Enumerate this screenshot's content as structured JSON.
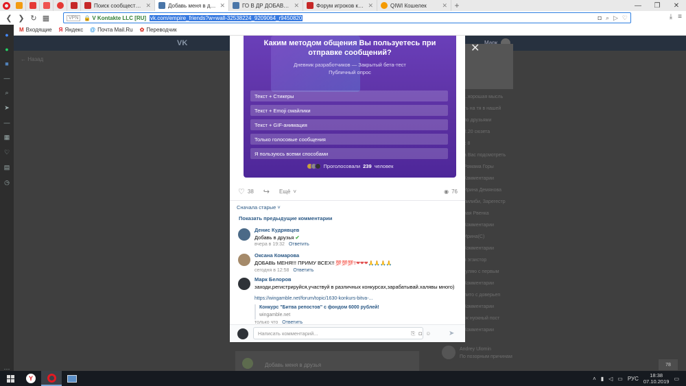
{
  "browser": {
    "tabs": [
      {
        "label": "Поиск сообщесто по загол",
        "favicon_color": "#c62828"
      },
      {
        "label": "Добавь меня в друзья",
        "favicon_color": "#4a76a8",
        "active": true
      },
      {
        "label": "ГО В ДР ДОБАВЬ В ДРУЗЬЯ",
        "favicon_color": "#4a76a8"
      },
      {
        "label": "Форум игроков казино - ",
        "favicon_color": "#c62828"
      },
      {
        "label": "QIWI Кошелек",
        "favicon_color": "#f59b00"
      }
    ],
    "address": {
      "vpn": "VPN",
      "security_label": "V Kontakte LLC [RU]",
      "url": "vk.com/empire_friends?w=wall-32538224_9209064_r9450820"
    },
    "bookmarks": [
      {
        "label": "Входящие",
        "icon": "gmail-icon",
        "color": "#d93025"
      },
      {
        "label": "Яндекс",
        "icon": "yandex-icon",
        "color": "#e21a22"
      },
      {
        "label": "Почта Mail.Ru",
        "icon": "mailru-icon",
        "color": "#168de2"
      },
      {
        "label": "Переводчик",
        "icon": "translate-icon",
        "color": "#d93025"
      }
    ]
  },
  "vk_header": {
    "logo": "VK",
    "user": "Марк"
  },
  "background_page": {
    "back_link": "Назад",
    "right_column": [
      "...хорошая мысль",
      "ть на тя в нашей",
      "по друзьями",
      "2.20 сюзета",
      "с 8",
      "а Вас подсмотреть",
      "Ромама Горы",
      "Камментарии",
      "Ирина Демянова",
      "лилиби, Зарегестр",
      "ная Рвенка",
      "Комментарии",
      "Ирина(С)",
      "Комментарии",
      "в эгзистор",
      "гуляю с первым",
      "Комментарии",
      "лито с доверьеп",
      "Комментарии",
      "ок нуокный пост",
      "Комментарии"
    ],
    "bottom_post_title": "Добавь меня в друзья",
    "bottom_author": "Andrey Ulomin",
    "bottom_author_meta": "По позорным причинам"
  },
  "post": {
    "poll": {
      "question": "Каким методом общения Вы пользуетесь при отправке сообщений?",
      "subtitle": "Дневник разработчиков — Закрытый бета-тест",
      "type": "Публичный опрос",
      "options": [
        "Текст + Стикеры",
        "Текст + Emoji смайлики",
        "Текст + GIF-анимация",
        "Только голосовые сообщения",
        "Я пользуюсь всеми способами"
      ],
      "voted_prefix": "Проголосовали",
      "voted_count": "239",
      "voted_suffix": "человек"
    },
    "actions": {
      "likes": "38",
      "more": "Ещё",
      "views": "76"
    },
    "sort_label": "Сначала старые",
    "show_previous": "Показать предыдущие комментарии",
    "comments": [
      {
        "author": "Денис Кудрявцев",
        "text": "Добавь в друзья",
        "time": "вчера в 19:32",
        "reply": "Ответить",
        "avatar_color": "#4b6a87"
      },
      {
        "author": "Оксана Комарова",
        "text": "ДОБАВЬ МЕНЯ!!! ПРИМУ ВСЕХ!!",
        "time": "сегодня в 12:58",
        "reply": "Ответить",
        "avatar_color": "#a58a6a"
      },
      {
        "author": "Марк Белоров",
        "text": "заходи,регистрируйся,участвуй в различных конкурсах,зарабатывай.халявы много)",
        "link_url": "https://wingamble.net/forum/topic/1630-konkurs-bitva-...",
        "link_title": "Конкурс \"Битва репостов\" с фондом 6000 рублей!",
        "link_domain": "wingamble.net",
        "time": "только что",
        "reply": "Ответить",
        "avatar_color": "#2f3338"
      }
    ],
    "reply_placeholder": "Написать комментарий..."
  },
  "taskbar": {
    "lang": "РУС",
    "time": "18:38",
    "date": "07.10.2019",
    "notif": "78"
  }
}
